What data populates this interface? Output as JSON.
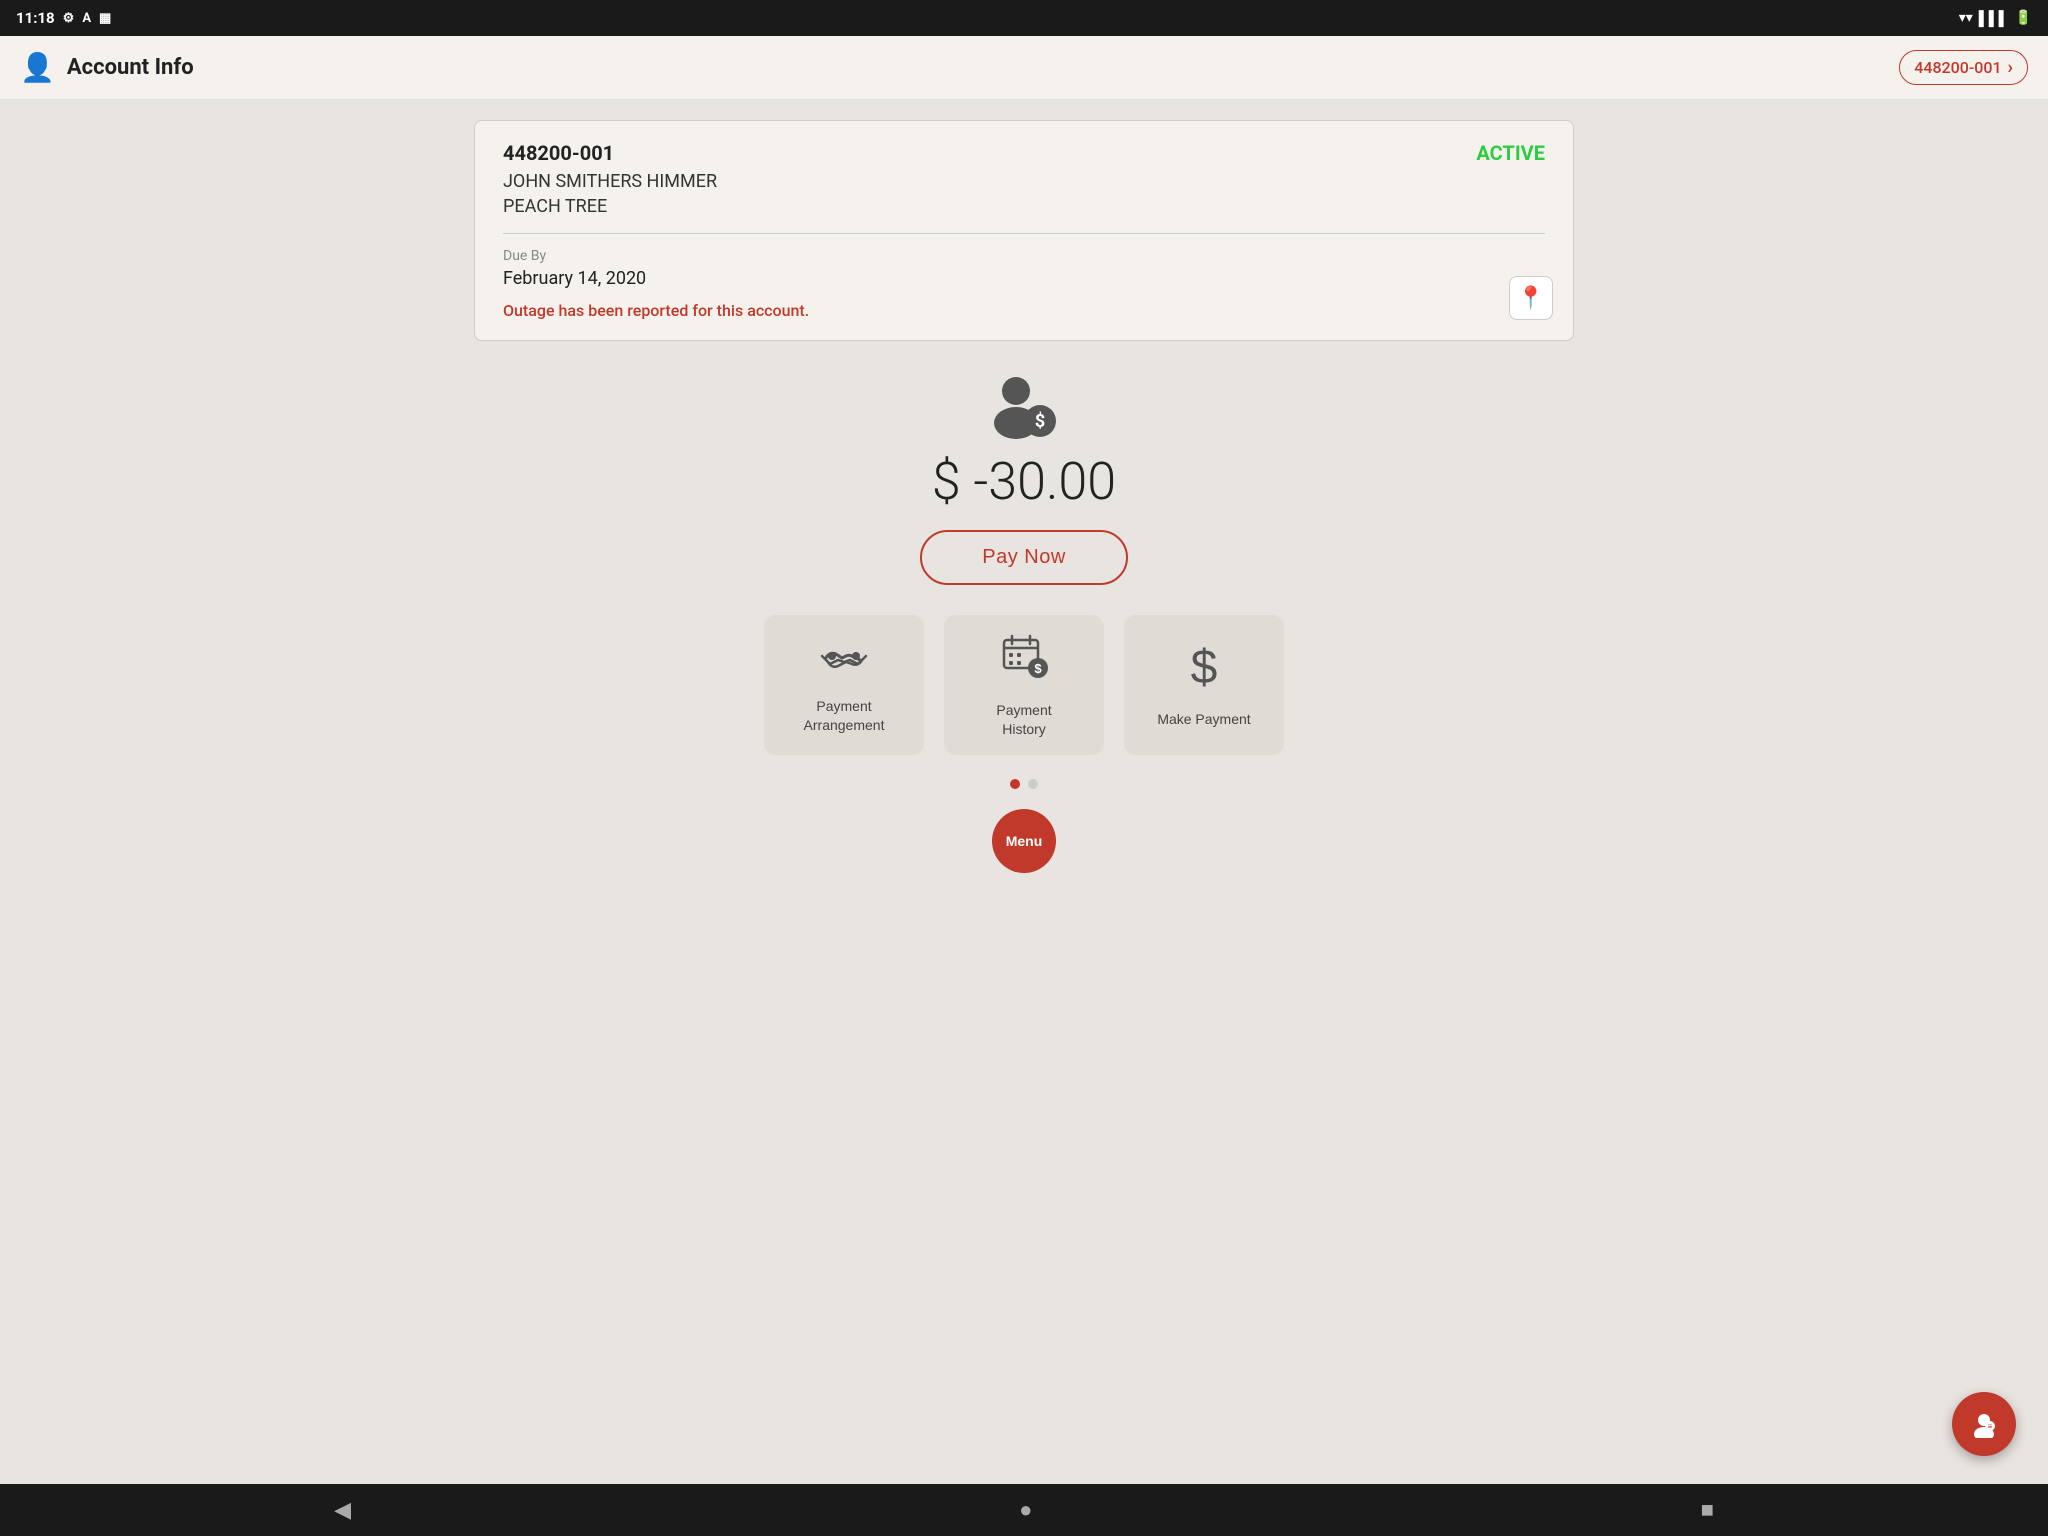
{
  "statusBar": {
    "time": "11:18",
    "icons": [
      "settings",
      "accessibility",
      "sim"
    ]
  },
  "appBar": {
    "title": "Account Info",
    "accountChip": {
      "number": "448200-001",
      "arrow": "›"
    }
  },
  "accountCard": {
    "accountNumber": "448200-001",
    "status": "ACTIVE",
    "name": "JOHN SMITHERS HIMMER",
    "location": "PEACH TREE",
    "dueByLabel": "Due By",
    "dueByDate": "February 14, 2020",
    "outageMessage": "Outage has been reported for this account."
  },
  "balance": {
    "amount": "$ -30.00",
    "payNowLabel": "Pay Now"
  },
  "actions": [
    {
      "id": "payment-arrangement",
      "label": "Payment\nArrangement",
      "iconType": "handshake"
    },
    {
      "id": "payment-history",
      "label": "Payment\nHistory",
      "iconType": "calendar-dollar"
    },
    {
      "id": "make-payment",
      "label": "Make Payment",
      "iconType": "dollar"
    }
  ],
  "dots": [
    {
      "active": true
    },
    {
      "active": false
    }
  ],
  "menuLabel": "Menu",
  "fab": {
    "icon": "👤",
    "ariaLabel": "Contact"
  },
  "navbar": {
    "back": "◀",
    "home": "●",
    "recent": "■"
  }
}
